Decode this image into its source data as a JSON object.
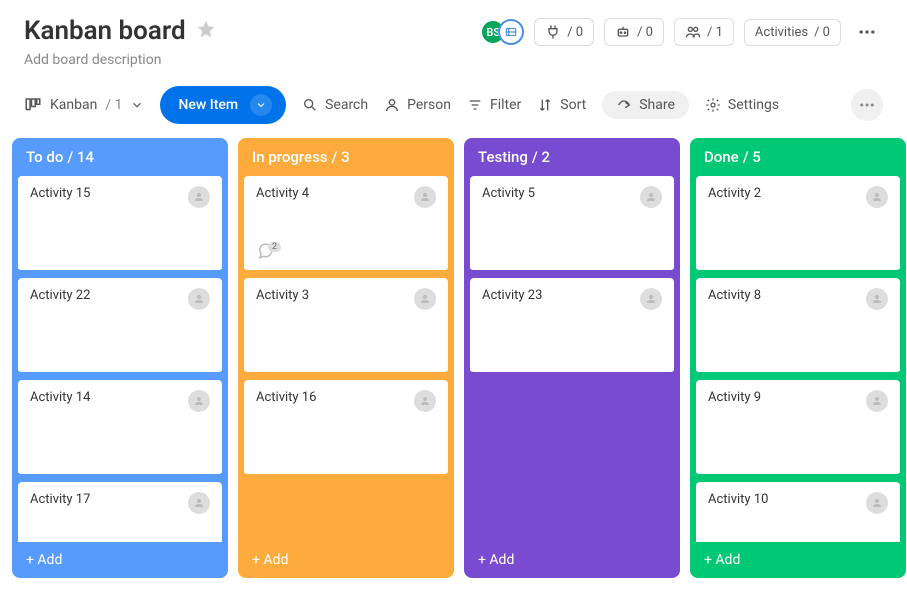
{
  "header": {
    "title": "Kanban board",
    "description": "Add board description",
    "avatars": {
      "initials": "BS"
    },
    "pills": {
      "pull": "/ 0",
      "robot": "/ 0",
      "people": "/ 1",
      "activities_label": "Activities",
      "activities_count": "/ 0"
    }
  },
  "toolbar": {
    "view_label": "Kanban",
    "view_count": "/ 1",
    "new_item": "New Item",
    "search": "Search",
    "person": "Person",
    "filter": "Filter",
    "sort": "Sort",
    "share": "Share",
    "settings": "Settings"
  },
  "columns": [
    {
      "id": "todo",
      "title": "To do",
      "count": "/ 14",
      "color_class": "col-todo",
      "cards": [
        {
          "title": "Activity 15",
          "chat_count": null
        },
        {
          "title": "Activity 22",
          "chat_count": null
        },
        {
          "title": "Activity 14",
          "chat_count": null
        },
        {
          "title": "Activity 17",
          "chat_count": null
        }
      ],
      "add_label": "+ Add"
    },
    {
      "id": "progress",
      "title": "In progress",
      "count": "/ 3",
      "color_class": "col-progress",
      "cards": [
        {
          "title": "Activity 4",
          "chat_count": "2"
        },
        {
          "title": "Activity 3",
          "chat_count": null
        },
        {
          "title": "Activity 16",
          "chat_count": null
        }
      ],
      "add_label": "+ Add"
    },
    {
      "id": "testing",
      "title": "Testing",
      "count": "/ 2",
      "color_class": "col-testing",
      "cards": [
        {
          "title": "Activity 5",
          "chat_count": null
        },
        {
          "title": "Activity 23",
          "chat_count": null
        }
      ],
      "add_label": "+ Add"
    },
    {
      "id": "done",
      "title": "Done",
      "count": "/ 5",
      "color_class": "col-done",
      "cards": [
        {
          "title": "Activity 2",
          "chat_count": null
        },
        {
          "title": "Activity 8",
          "chat_count": null
        },
        {
          "title": "Activity 9",
          "chat_count": null
        },
        {
          "title": "Activity 10",
          "chat_count": null
        }
      ],
      "add_label": "+ Add"
    }
  ]
}
